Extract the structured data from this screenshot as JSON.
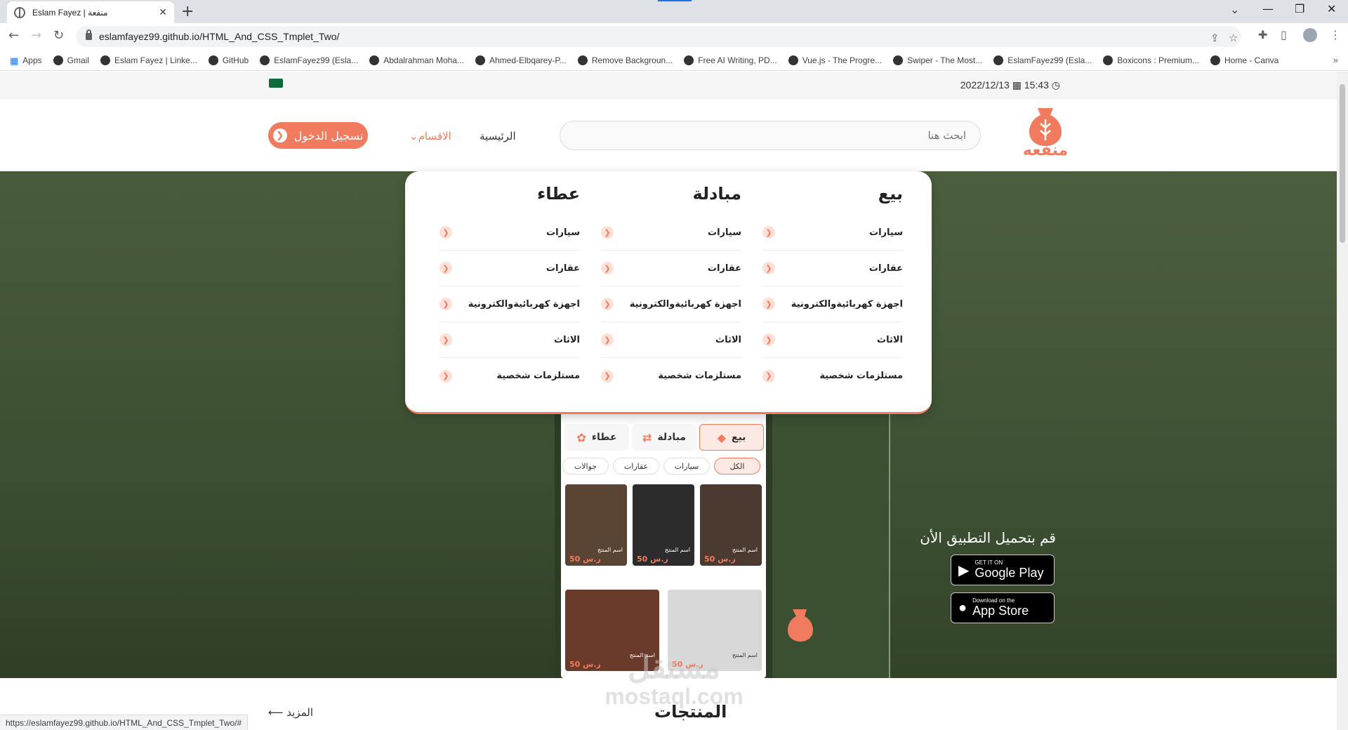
{
  "browser": {
    "tab_title": "Eslam Fayez | منفعة",
    "url": "eslamfayez99.github.io/HTML_And_CSS_Tmplet_Two/",
    "status_url": "https://eslamfayez99.github.io/HTML_And_CSS_Tmplet_Two/#",
    "bookmarks": [
      "Apps",
      "Gmail",
      "Eslam Fayez | Linke...",
      "GitHub",
      "EslamFayez99 (Esla...",
      "Abdalrahman Moha...",
      "Ahmed-Elbqarey-P...",
      "Remove Backgroun...",
      "Free AI Writing, PD...",
      "Vue.js - The Progre...",
      "Swiper - The Most...",
      "EslamFayez99 (Esla...",
      "Boxicons : Premium...",
      "Home - Canva"
    ]
  },
  "site": {
    "datetime": {
      "date": "2022/12/13",
      "time": "15:43"
    },
    "logo_text": "منفعه",
    "search_placeholder": "ابحث هنا",
    "nav": {
      "home": "الرئيسية",
      "categories": "الاقسام"
    },
    "login_button": "تسجيل الدخول",
    "mega_menu": [
      {
        "title": "بيع",
        "items": [
          "سيارات",
          "عقارات",
          "اجهزة كهربائيةوالكترونية",
          "الاثاث",
          "مستلزمات شخصية"
        ]
      },
      {
        "title": "مبادلة",
        "items": [
          "سيارات",
          "عقارات",
          "اجهزة كهربائيةوالكترونية",
          "الاثاث",
          "مستلزمات شخصية"
        ]
      },
      {
        "title": "عطاء",
        "items": [
          "سيارات",
          "عقارات",
          "اجهزة كهربائيةوالكترونية",
          "الاثاث",
          "مستلزمات شخصية"
        ]
      }
    ],
    "hero": {
      "download_text": "قم بتحميل التطبيق الأن",
      "google_play": {
        "small": "GET IT ON",
        "big": "Google Play"
      },
      "app_store": {
        "small": "Download on the",
        "big": "App Store"
      }
    },
    "phone": {
      "tabs": [
        "بيع",
        "مبادلة",
        "عطاء"
      ],
      "chips": [
        "الكل",
        "سيارات",
        "عقارات",
        "جوالات"
      ],
      "product_name": "اسم المنتج",
      "price": "50",
      "currency": "ر.س"
    },
    "products_title": "المنتجات",
    "more_link": "المزيد",
    "watermark": {
      "ar": "مستقل",
      "en": "mostaql.com"
    },
    "colors": {
      "accent": "#f07b5e",
      "hero_bg": "#3b5030"
    }
  }
}
